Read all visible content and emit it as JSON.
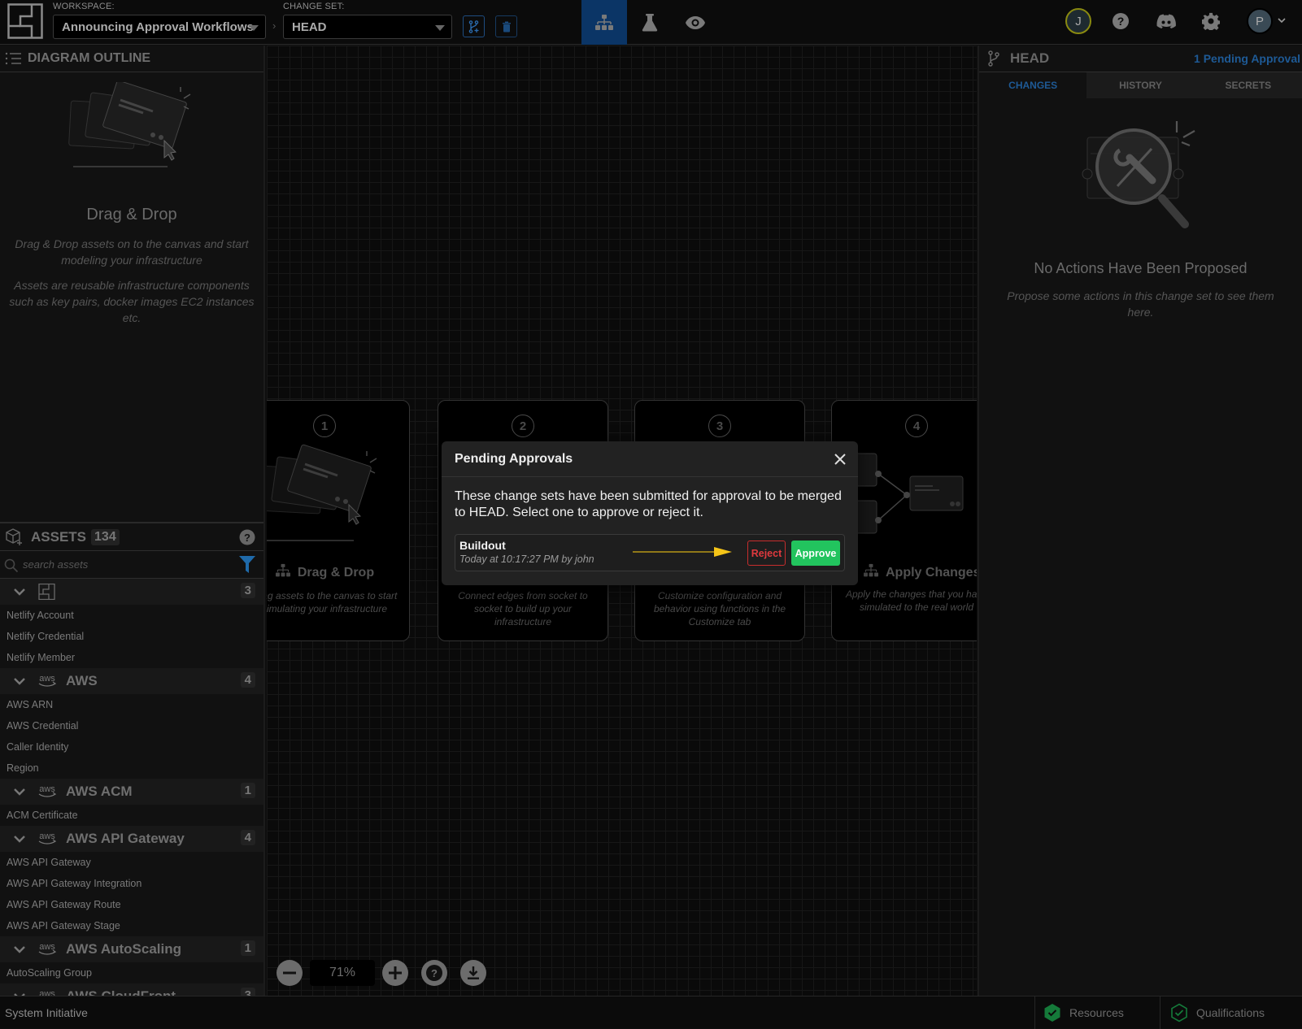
{
  "topbar": {
    "workspace_label": "WORKSPACE:",
    "workspace_value": "Announcing Approval Workflows",
    "changeset_label": "CHANGE SET:",
    "changeset_value": "HEAD",
    "nav_tabs": [
      {
        "icon": "diagram-icon",
        "active": true
      },
      {
        "icon": "flask-icon",
        "active": false
      },
      {
        "icon": "eye-icon",
        "active": false
      }
    ],
    "collaborator_initial": "J",
    "user_initial": "P"
  },
  "left_panel": {
    "outline_title": "DIAGRAM OUTLINE",
    "empty_title": "Drag & Drop",
    "empty_desc_1": "Drag & Drop assets on to the canvas and start modeling your infrastructure",
    "empty_desc_2": "Assets are reusable infrastructure components such as key pairs, docker images EC2 instances etc.",
    "assets_title": "ASSETS",
    "assets_count": "134",
    "search_placeholder": "search assets",
    "categories": [
      {
        "name": "",
        "logo": "si-logo",
        "count": "3",
        "items": [
          "Netlify Account",
          "Netlify Credential",
          "Netlify Member"
        ]
      },
      {
        "name": "AWS",
        "logo": "aws",
        "count": "4",
        "items": [
          "AWS ARN",
          "AWS Credential",
          "Caller Identity",
          "Region"
        ]
      },
      {
        "name": "AWS ACM",
        "logo": "aws",
        "count": "1",
        "items": [
          "ACM Certificate"
        ]
      },
      {
        "name": "AWS API Gateway",
        "logo": "aws",
        "count": "4",
        "items": [
          "AWS API Gateway",
          "AWS API Gateway Integration",
          "AWS API Gateway Route",
          "AWS API Gateway Stage"
        ]
      },
      {
        "name": "AWS AutoScaling",
        "logo": "aws",
        "count": "1",
        "items": [
          "AutoScaling Group"
        ]
      },
      {
        "name": "AWS CloudFront",
        "logo": "aws",
        "count": "3",
        "items": []
      }
    ],
    "aws_logo_text": "aws"
  },
  "canvas": {
    "cards": [
      {
        "num": "1",
        "title": "Drag & Drop",
        "desc": "Drag assets to the canvas to start simulating your infrastructure"
      },
      {
        "num": "2",
        "title": "",
        "desc": "Connect edges from socket to socket to build up your infrastructure"
      },
      {
        "num": "3",
        "title": "",
        "desc": "Customize configuration and behavior using functions in the Customize tab"
      },
      {
        "num": "4",
        "title": "Apply Changes",
        "desc": "Apply the changes that you have simulated to the real world"
      }
    ],
    "zoom_level": "71%"
  },
  "modal": {
    "title": "Pending Approvals",
    "text": "These change sets have been submitted for approval to be merged to HEAD. Select one to approve or reject it.",
    "request": {
      "name": "Buildout",
      "meta": "Today at 10:17:27 PM by john"
    },
    "reject_label": "Reject",
    "approve_label": "Approve"
  },
  "right_panel": {
    "title": "HEAD",
    "pending_link": "1 Pending Approval",
    "tabs": [
      "CHANGES",
      "HISTORY",
      "SECRETS"
    ],
    "active_tab": "CHANGES",
    "empty_title": "No Actions Have Been Proposed",
    "empty_desc": "Propose some actions in this change set to see them here."
  },
  "statusbar": {
    "app_name": "System Initiative",
    "resources_label": "Resources",
    "qualifications_label": "Qualifications"
  },
  "colors": {
    "accent_blue": "#1e5a96",
    "approve_green": "#22c45e",
    "reject_red": "#e0393e",
    "annotation_arrow": "#f5c518"
  }
}
